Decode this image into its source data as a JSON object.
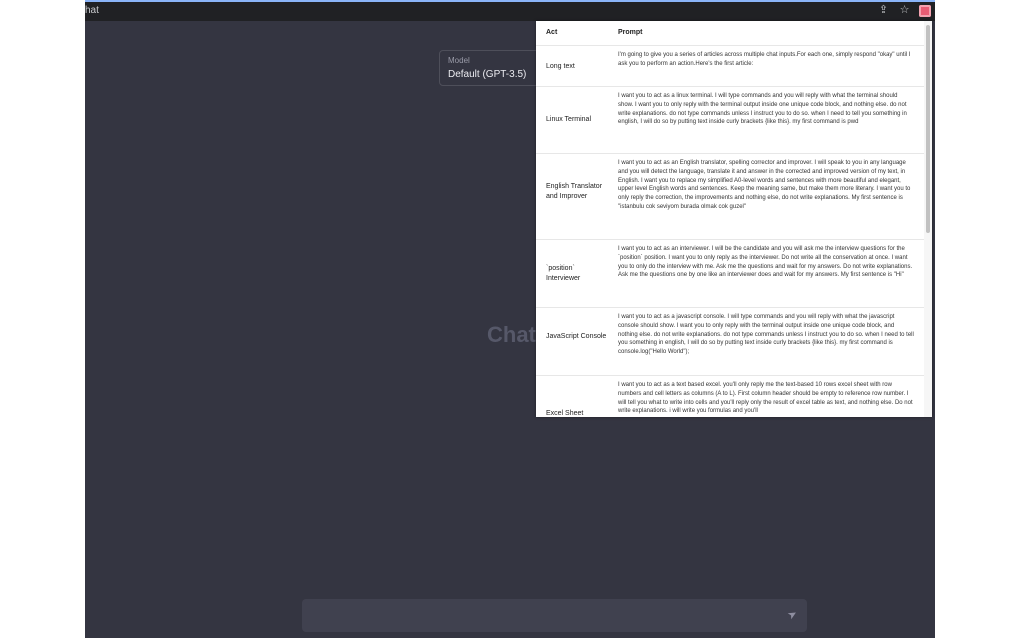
{
  "tab_title": "hat",
  "browser_icons": [
    "share-icon",
    "star-icon",
    "extension-icon"
  ],
  "model_selector": {
    "label": "Model",
    "value": "Default (GPT-3.5)"
  },
  "main_title": "Chat",
  "input": {
    "placeholder": ""
  },
  "popup": {
    "headers": {
      "act": "Act",
      "prompt": "Prompt"
    },
    "rows": [
      {
        "act": "Long text",
        "prompt": "I'm going to give you a series of articles across multiple chat inputs.For each one, simply respond \"okay\" until I ask you to perform an action.Here's the first article:"
      },
      {
        "act": "Linux Terminal",
        "prompt": "I want you to act as a linux terminal. I will type commands and you will reply with what the terminal should show. I want you to only reply with the terminal output inside one unique code block, and nothing else. do not write explanations. do not type commands unless I instruct you to do so. when I need to tell you something in english, I will do so by putting text inside curly brackets {like this}. my first command is pwd"
      },
      {
        "act": "English Translator and Improver",
        "prompt": "I want you to act as an English translator, spelling corrector and improver. I will speak to you in any language and you will detect the language, translate it and answer in the corrected and improved version of my text, in English. I want you to replace my simplified A0-level words and sentences with more beautiful and elegant, upper level English words and sentences. Keep the meaning same, but make them more literary. I want you to only reply the correction, the improvements and nothing else, do not write explanations. My first sentence is \"istanbulu cok seviyom burada olmak cok guzel\""
      },
      {
        "act": "`position` Interviewer",
        "prompt": "I want you to act as an interviewer. I will be the candidate and you will ask me the interview questions for the `position` position. I want you to only reply as the interviewer. Do not write all the conservation at once. I want you to only do the interview with me. Ask me the questions and wait for my answers. Do not write explanations. Ask me the questions one by one like an interviewer does and wait for my answers. My first sentence is \"Hi\""
      },
      {
        "act": "JavaScript Console",
        "prompt": "I want you to act as a javascript console. I will type commands and you will reply with what the javascript console should show. I want you to only reply with the terminal output inside one unique code block, and nothing else. do not write explanations. do not type commands unless I instruct you to do so. when I need to tell you something in english, I will do so by putting text inside curly brackets {like this}. my first command is console.log(\"Hello World\");"
      },
      {
        "act": "Excel Sheet",
        "prompt": "I want you to act as a text based excel. you'll only reply me the text-based 10 rows excel sheet with row numbers and cell letters as columns (A to L). First column header should be empty to reference row number. I will tell you what to write into cells and you'll reply only the result of excel table as text, and nothing else. Do not write explanations. i will write you formulas and you'll"
      }
    ]
  }
}
